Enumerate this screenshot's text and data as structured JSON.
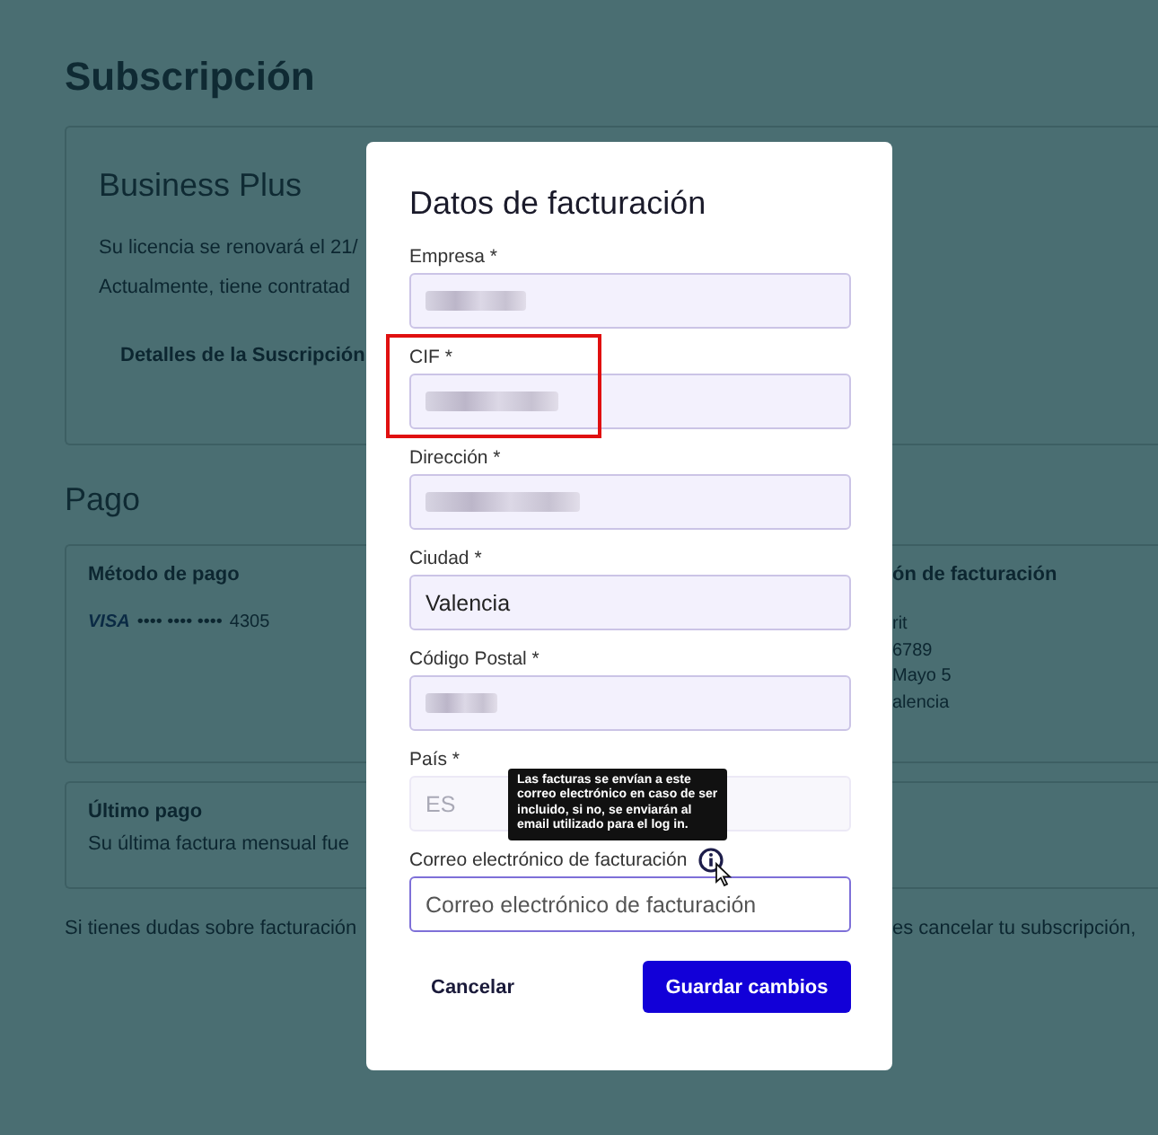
{
  "page": {
    "title": "Subscripción",
    "plan": {
      "name": "Business Plus",
      "lines": [
        "Su licencia se renovará el 21/",
        "Actualmente, tiene contratad"
      ],
      "link": "Detalles de la Suscripción"
    },
    "payment_heading": "Pago",
    "payment_method": {
      "title": "Método de pago",
      "card_brand": "VISA",
      "card_mask": "•••• •••• ••••",
      "card_last4": "4305"
    },
    "billing_address": {
      "title": "ón de facturación",
      "lines": [
        "rit",
        "6789",
        "Mayo 5",
        "alencia"
      ]
    },
    "last_payment": {
      "title": "Último pago",
      "text": "Su última factura mensual fue"
    },
    "footer_left": "Si tienes dudas sobre facturación",
    "footer_right": "es cancelar tu subscripción,"
  },
  "dialog": {
    "title": "Datos de facturación",
    "fields": [
      {
        "label": "Empresa *",
        "redacted": true,
        "highlighted": false,
        "disabled": false,
        "focused": false
      },
      {
        "label": "CIF *",
        "redacted": true,
        "highlighted": true,
        "disabled": false,
        "focused": false
      },
      {
        "label": "Dirección *",
        "redacted": true,
        "highlighted": false,
        "disabled": false,
        "focused": false
      },
      {
        "label": "Ciudad *",
        "value": "Valencia",
        "redacted": false,
        "highlighted": false,
        "disabled": false,
        "focused": false
      },
      {
        "label": "Código Postal *",
        "redacted": true,
        "highlighted": false,
        "disabled": false,
        "focused": false
      },
      {
        "label": "País *",
        "value": "ES",
        "redacted": false,
        "highlighted": false,
        "disabled": true,
        "focused": false
      },
      {
        "label": "Correo electrónico de facturación",
        "placeholder": "Correo electrónico de facturación",
        "redacted": false,
        "highlighted": false,
        "disabled": false,
        "focused": true,
        "tooltip": [
          "Las facturas se envían a este",
          "correo electrónico en caso de ser",
          "incluido, si no, se enviarán al",
          "email utilizado para el log in."
        ]
      }
    ],
    "buttons": [
      {
        "label": "Cancelar",
        "kind": "secondary"
      },
      {
        "label": "Guardar cambios",
        "kind": "primary"
      }
    ]
  }
}
